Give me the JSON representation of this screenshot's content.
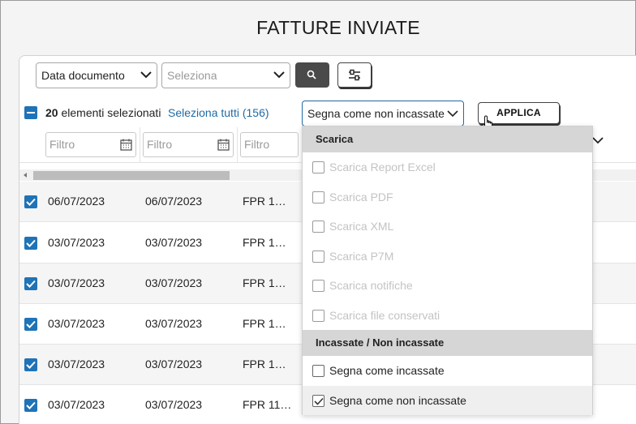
{
  "page": {
    "title": "FATTURE INVIATE"
  },
  "filters": {
    "date_type": "Data documento",
    "select_placeholder": "Seleziona"
  },
  "selection": {
    "count": "20",
    "count_suffix": " elementi selezionati",
    "select_all": "Seleziona tutti (156)",
    "action_value": "Segna come non incassate",
    "apply_label": "APPLICA"
  },
  "column_filters": {
    "placeholder": "Filtro"
  },
  "rows": [
    {
      "date1": "06/07/2023",
      "date2": "06/07/2023",
      "number": "FPR 1…"
    },
    {
      "date1": "03/07/2023",
      "date2": "03/07/2023",
      "number": "FPR 1…"
    },
    {
      "date1": "03/07/2023",
      "date2": "03/07/2023",
      "number": "FPR 1…"
    },
    {
      "date1": "03/07/2023",
      "date2": "03/07/2023",
      "number": "FPR 1…"
    },
    {
      "date1": "03/07/2023",
      "date2": "03/07/2023",
      "number": "FPR 1…"
    },
    {
      "date1": "03/07/2023",
      "date2": "03/07/2023",
      "number": "FPR 11…"
    }
  ],
  "menu": {
    "group1": "Scarica",
    "group1_items": [
      "Scarica Report Excel",
      "Scarica PDF",
      "Scarica XML",
      "Scarica P7M",
      "Scarica notifiche",
      "Scarica file conservati"
    ],
    "group2": "Incassate / Non incassate",
    "group2_items": [
      "Segna come incassate",
      "Segna come non incassate"
    ]
  },
  "colors": {
    "accent": "#1f73b7",
    "link": "#1f6aa5"
  }
}
